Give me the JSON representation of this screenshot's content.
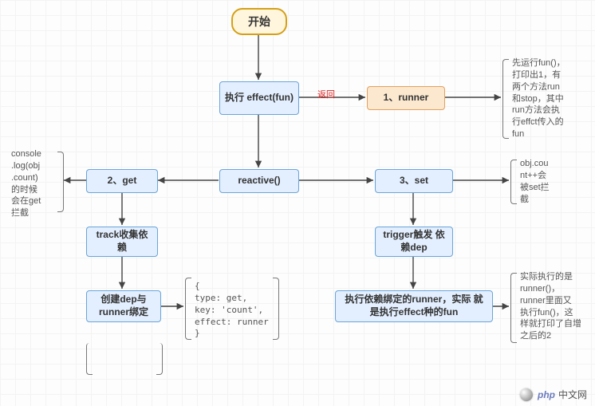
{
  "nodes": {
    "start": "开始",
    "effect": "执行\neffect(fun)",
    "runner": "1、runner",
    "reactive": "reactive()",
    "get": "2、get",
    "set": "3、set",
    "track": "track收集依\n赖",
    "trigger": "trigger触发\n依赖dep",
    "createDep": "创建dep与\nrunner绑定",
    "execDep": "执行依赖绑定的runner，实际\n就是执行effect种的fun"
  },
  "edgeLabels": {
    "return": "返回"
  },
  "notes": {
    "getNote": "console\n.log(obj\n.count)\n的时候\n会在get\n拦截",
    "runnerNote": "先运行fun()，\n打印出1，有\n两个方法run\n和stop，其中\nrun方法会执\n行effct传入的\nfun",
    "setNote": "obj.cou\nnt++会\n被set拦\n截",
    "depStruct": "{\n  type: get,\n  key: 'count',\n  effect: runner\n}",
    "execNote": "实际执行的是\nrunner()，\nrunner里面又\n执行fun()，这\n样就打印了自增\n之后的2"
  },
  "logo": {
    "php": "php",
    "cn": "中文网"
  }
}
